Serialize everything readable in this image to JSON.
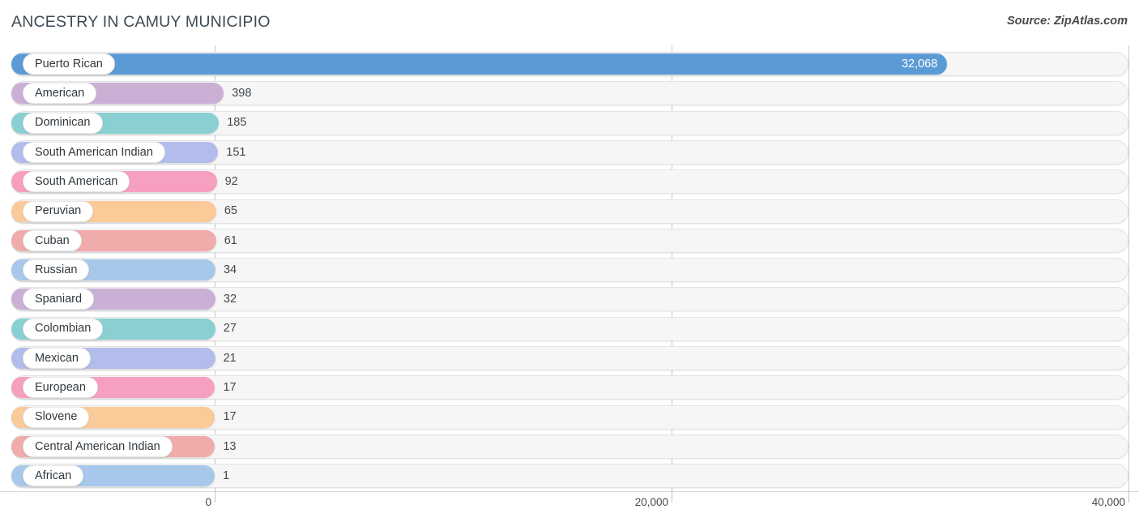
{
  "header": {
    "title": "ANCESTRY IN CAMUY MUNICIPIO",
    "source": "Source: ZipAtlas.com"
  },
  "axis": {
    "ticks": [
      {
        "label": "0",
        "value": 0
      },
      {
        "label": "20,000",
        "value": 20000
      },
      {
        "label": "40,000",
        "value": 40000
      }
    ]
  },
  "chart_data": {
    "type": "bar",
    "orientation": "horizontal",
    "title": "ANCESTRY IN CAMUY MUNICIPIO",
    "xlabel": "",
    "ylabel": "",
    "xlim": [
      0,
      40000
    ],
    "grid": true,
    "legend": false,
    "source": "Source: ZipAtlas.com",
    "categories": [
      "Puerto Rican",
      "American",
      "Dominican",
      "South American Indian",
      "South American",
      "Peruvian",
      "Cuban",
      "Russian",
      "Spaniard",
      "Colombian",
      "Mexican",
      "European",
      "Slovene",
      "Central American Indian",
      "African"
    ],
    "values": [
      32068,
      398,
      185,
      151,
      92,
      65,
      61,
      34,
      32,
      27,
      21,
      17,
      17,
      13,
      1
    ],
    "value_labels": [
      "32,068",
      "398",
      "185",
      "151",
      "92",
      "65",
      "61",
      "34",
      "32",
      "27",
      "21",
      "17",
      "17",
      "13",
      "1"
    ],
    "colors": [
      "#5b9bd5",
      "#cbb0d6",
      "#8ad0d2",
      "#b2bdec",
      "#f79fc0",
      "#fbca99",
      "#f0acaa",
      "#a7c8ea",
      "#cbb0d6",
      "#8ad0d2",
      "#b2bdec",
      "#f79fc0",
      "#fbca99",
      "#f0acaa",
      "#a7c8ea"
    ]
  }
}
